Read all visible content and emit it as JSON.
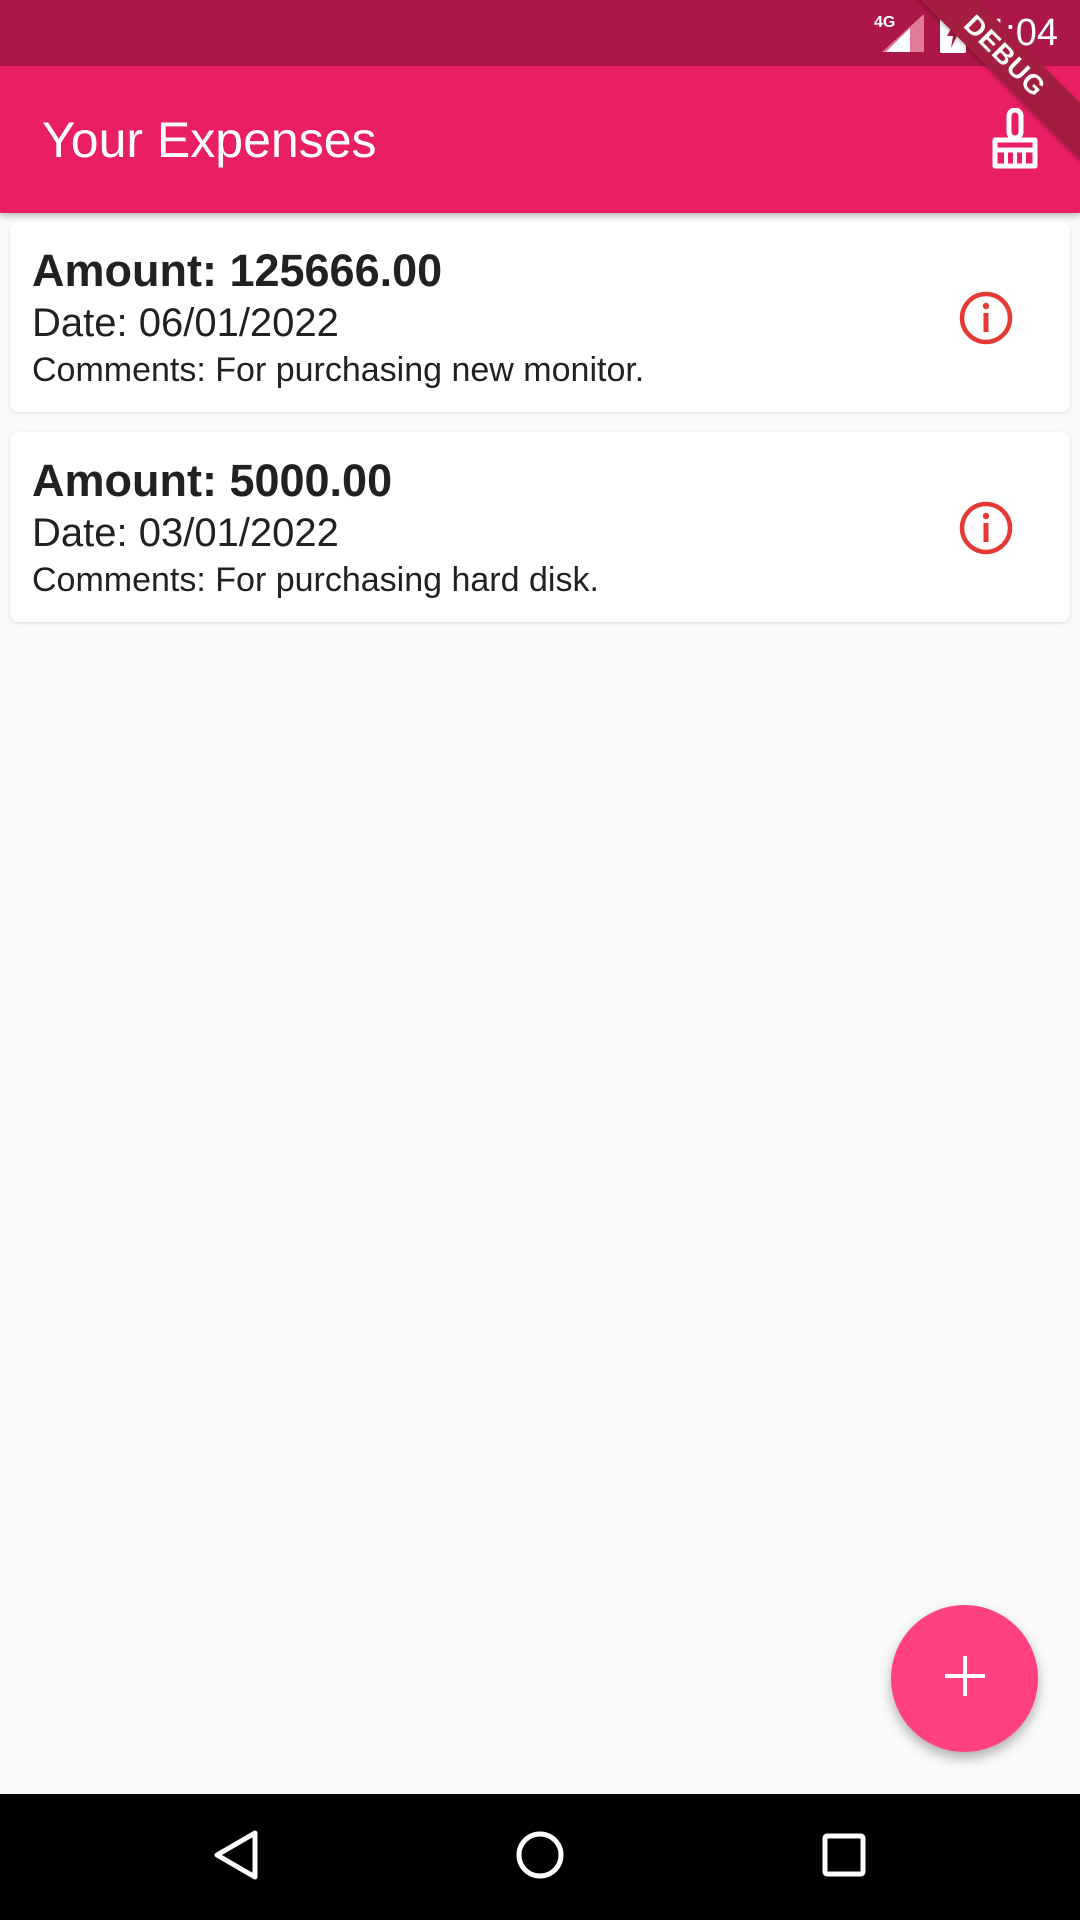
{
  "status_bar": {
    "time": "4:04",
    "network": "4G",
    "debug_ribbon": "DEBUG"
  },
  "app_bar": {
    "title": "Your Expenses",
    "clear_icon": "broom-icon",
    "color": "#e91e63"
  },
  "expenses": [
    {
      "amount": "Amount: 125666.00",
      "date": "Date: 06/01/2022",
      "comments": "Comments: For purchasing new monitor.",
      "icon": "info-icon"
    },
    {
      "amount": "Amount: 5000.00",
      "date": "Date: 03/01/2022",
      "comments": "Comments: For purchasing hard disk.",
      "icon": "info-icon"
    }
  ],
  "fab": {
    "icon": "plus-icon",
    "color": "#ff4081"
  },
  "nav": {
    "back_icon": "back-triangle-icon",
    "home_icon": "home-circle-icon",
    "recents_icon": "recents-square-icon"
  },
  "colors": {
    "status_bar": "#ad1748",
    "info_icon": "#e53935",
    "background": "#fafafa"
  }
}
